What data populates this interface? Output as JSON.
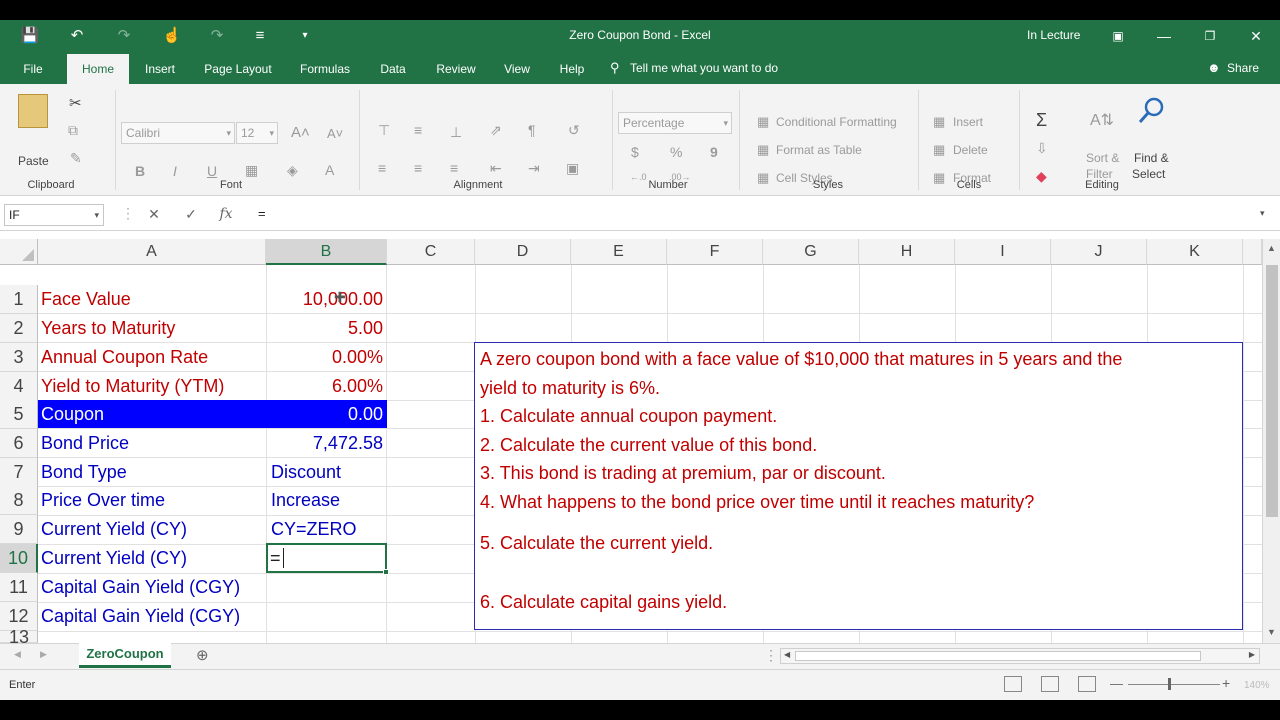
{
  "window": {
    "title": "Zero Coupon Bond  -  Excel",
    "user": "In Lecture"
  },
  "tabs": [
    "File",
    "Home",
    "Insert",
    "Page Layout",
    "Formulas",
    "Data",
    "Review",
    "View",
    "Help"
  ],
  "tell_me": "Tell me what you want to do",
  "share": "Share",
  "ribbon": {
    "clipboard": {
      "label": "Clipboard",
      "paste": "Paste"
    },
    "font": {
      "label": "Font",
      "name": "Calibri",
      "size": "12",
      "bold": "B",
      "italic": "I",
      "underline": "U"
    },
    "alignment": {
      "label": "Alignment"
    },
    "number": {
      "label": "Number",
      "format": "Percentage",
      "currency": "$",
      "percent": "%",
      "comma": "9"
    },
    "styles": {
      "label": "Styles",
      "conditional": "Conditional Formatting",
      "table": "Format as Table",
      "cell_styles": "Cell Styles"
    },
    "cells": {
      "label": "Cells",
      "insert": "Insert",
      "delete": "Delete",
      "format": "Format"
    },
    "editing": {
      "label": "Editing",
      "sort": "Sort &",
      "filter": "Filter",
      "find": "Find &",
      "select": "Select"
    }
  },
  "formula_bar": {
    "name_box": "IF",
    "content": "="
  },
  "columns": [
    "A",
    "B",
    "C",
    "D",
    "E",
    "F",
    "G",
    "H",
    "I",
    "J",
    "K"
  ],
  "rows": [
    "1",
    "2",
    "3",
    "4",
    "5",
    "6",
    "7",
    "8",
    "9",
    "10",
    "11",
    "12",
    "13"
  ],
  "cells": [
    {
      "label": "Face Value",
      "value": "10,000.00"
    },
    {
      "label": "Years to Maturity",
      "value": "5.00"
    },
    {
      "label": "Annual Coupon Rate",
      "value": "0.00%"
    },
    {
      "label": "Yield to Maturity (YTM)",
      "value": "6.00%"
    },
    {
      "label": "Coupon",
      "value": "0.00"
    },
    {
      "label": "Bond Price",
      "value": "7,472.58"
    },
    {
      "label": "Bond Type",
      "value": "Discount"
    },
    {
      "label": "Price Over time",
      "value": "Increase"
    },
    {
      "label": "Current Yield (CY)",
      "value": "CY=ZERO"
    },
    {
      "label": "Current Yield (CY)",
      "value": "="
    },
    {
      "label": "Capital Gain Yield (CGY)",
      "value": ""
    },
    {
      "label": "Capital Gain Yield (CGY)",
      "value": ""
    }
  ],
  "textbox": {
    "intro_1": "A zero coupon bond with a face value of $10,000 that matures in 5 years and the",
    "intro_2": "yield to maturity is 6%.",
    "q1": "1. Calculate annual coupon payment.",
    "q2": "2. Calculate the current value of this bond.",
    "q3": "3. This bond is trading at premium, par or discount.",
    "q4": "4. What happens to the bond price over time until it reaches maturity?",
    "q5": "5. Calculate the current yield.",
    "q6": "6. Calculate capital gains yield."
  },
  "sheet_tab": "ZeroCoupon",
  "status": {
    "mode": "Enter",
    "zoom": "140%"
  },
  "colors": {
    "excel_green": "#217346",
    "label_red": "#c00000",
    "label_blue": "#0000c0",
    "highlight": "#0000ff"
  }
}
